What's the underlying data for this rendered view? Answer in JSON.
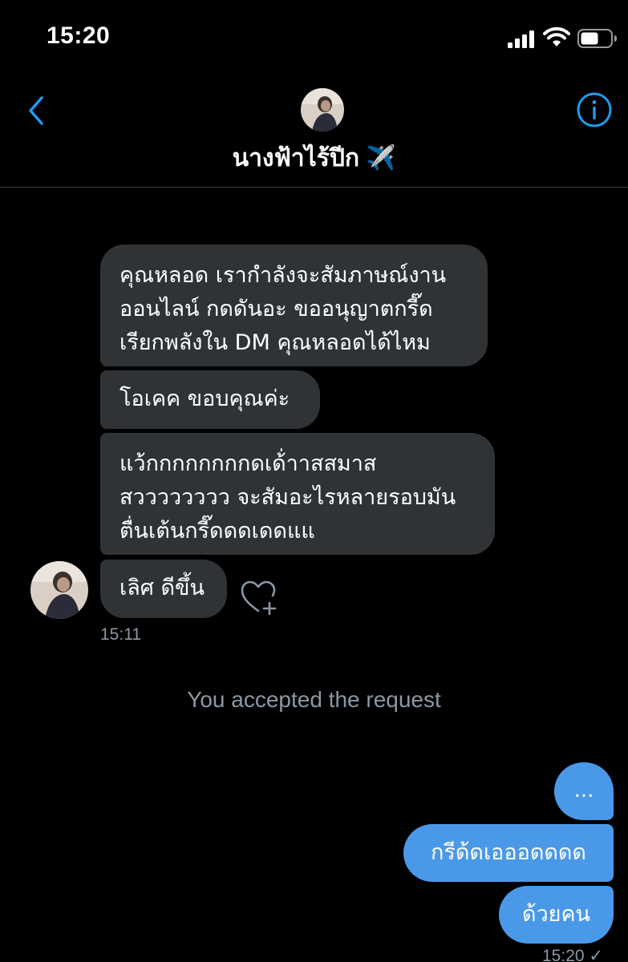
{
  "status_bar": {
    "time": "15:20"
  },
  "header": {
    "title": "นางฟ้าไร้ปีก",
    "title_emoji": "✈️",
    "accent_color": "#1d9bf0"
  },
  "messages_in": [
    {
      "text": "คุณหลอด เรากำลังจะสัมภาษณ์งาน\nออนไลน์ กดดันอะ ขออนุญาตกรี๊ด\nเรียกพลังใน DM คุณหลอดได้ไหม"
    },
    {
      "text": "โอเคค ขอบคุณค่ะ"
    },
    {
      "text": "แว้กกกกกกกกดเด้่าาสสมาส\nสวววววววว จะสัมอะไรหลายรอบมัน\nตื่นเต้นกรี๊ดดดเดดแแ"
    },
    {
      "text": "เลิศ ดีขึ้น"
    }
  ],
  "time_in": "15:11",
  "system_message": "You accepted the request",
  "messages_out": [
    {
      "text": "..."
    },
    {
      "text": "กรีด้ดเอออดดดด"
    },
    {
      "text": "ด้วยคน"
    }
  ],
  "time_out": "15:20 ✓",
  "colors": {
    "background": "#000000",
    "incoming_bubble": "#2f3336",
    "outgoing_bubble": "#4a99e9",
    "muted_text": "#8b98a5"
  }
}
